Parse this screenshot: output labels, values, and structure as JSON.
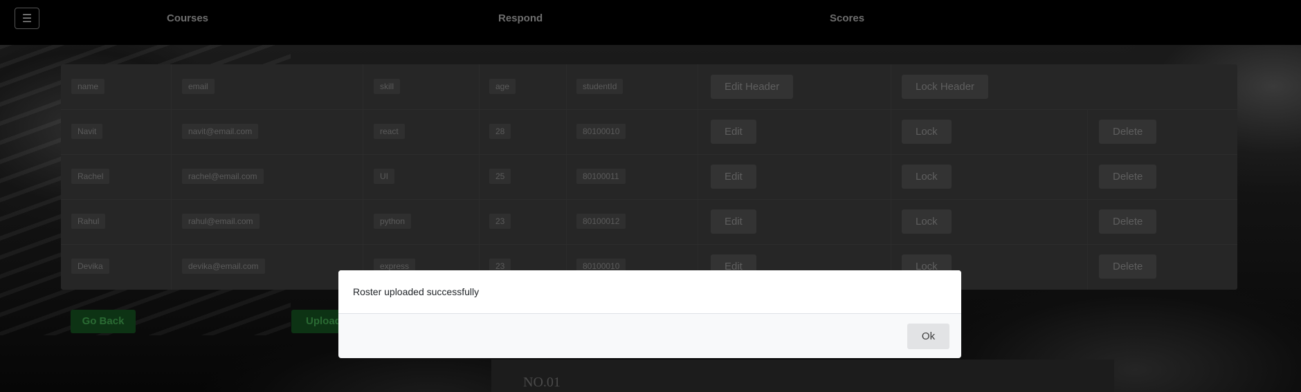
{
  "nav": {
    "menu_icon": "☰",
    "links": [
      "Courses",
      "Respond",
      "Scores"
    ]
  },
  "table": {
    "header": {
      "cells": [
        "name",
        "email",
        "skill",
        "age",
        "studentId"
      ],
      "edit_label": "Edit Header",
      "lock_label": "Lock Header"
    },
    "rows": [
      {
        "cells": [
          "Navit",
          "navit@email.com",
          "react",
          "28",
          "80100010"
        ],
        "edit": "Edit",
        "lock": "Lock",
        "delete": "Delete"
      },
      {
        "cells": [
          "Rachel",
          "rachel@email.com",
          "UI",
          "25",
          "80100011"
        ],
        "edit": "Edit",
        "lock": "Lock",
        "delete": "Delete"
      },
      {
        "cells": [
          "Rahul",
          "rahul@email.com",
          "python",
          "23",
          "80100012"
        ],
        "edit": "Edit",
        "lock": "Lock",
        "delete": "Delete"
      },
      {
        "cells": [
          "Devika",
          "devika@email.com",
          "express",
          "23",
          "80100010"
        ],
        "edit": "Edit",
        "lock": "Lock",
        "delete": "Delete"
      }
    ]
  },
  "actions": {
    "go_back": "Go Back",
    "upload": "Upload"
  },
  "modal": {
    "message": "Roster uploaded successfully",
    "ok": "Ok"
  },
  "background": {
    "paper_text": "NO.01"
  },
  "colors": {
    "overlay": "#000000",
    "modal_bg": "#ffffff",
    "go_back_green": "#0d3314"
  }
}
